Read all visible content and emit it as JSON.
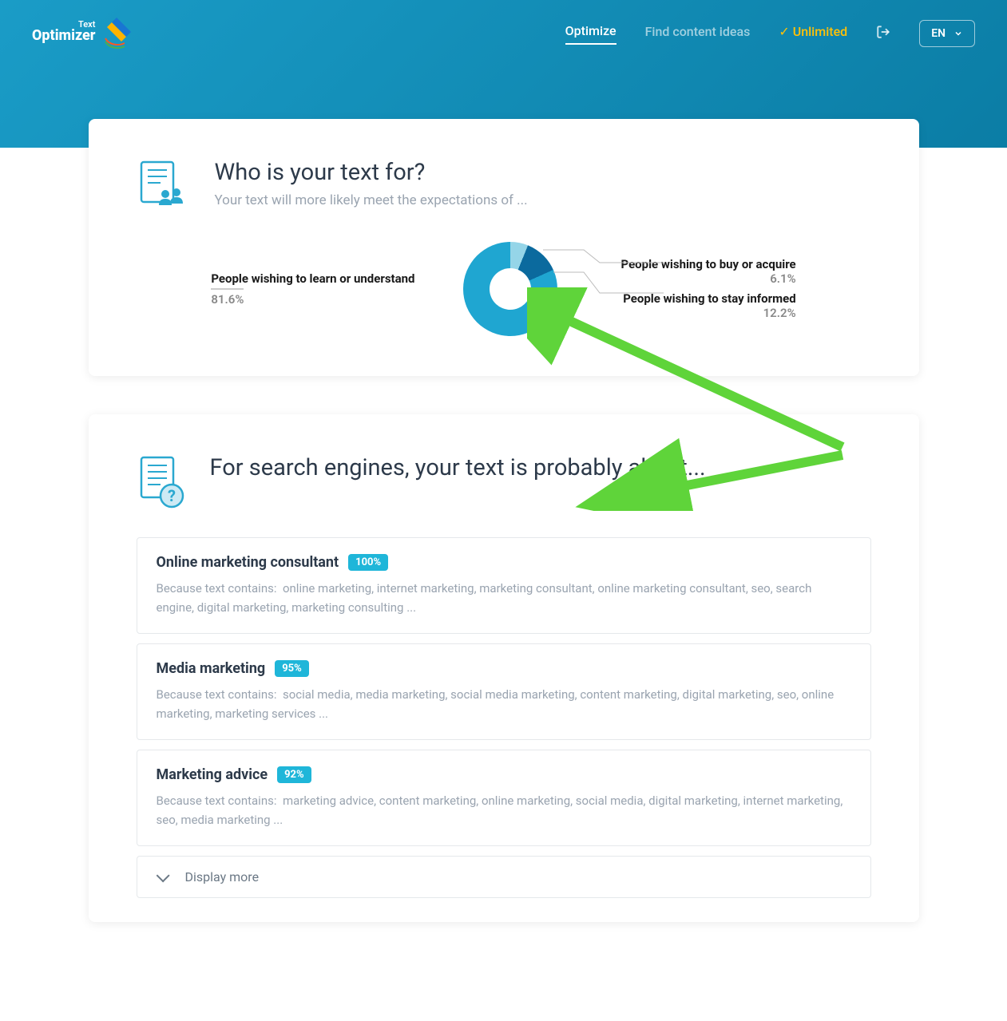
{
  "brand": "Text Optimizer",
  "nav": {
    "optimize": "Optimize",
    "find_ideas": "Find content ideas",
    "unlimited": "Unlimited",
    "lang": "EN"
  },
  "card1": {
    "title": "Who is your text for?",
    "subtitle": "Your text will more likely meet the expectations of ..."
  },
  "chart_data": {
    "type": "pie",
    "title": "Who is your text for?",
    "series": [
      {
        "name": "People wishing to learn or understand",
        "value": 81.6,
        "label": "81.6%"
      },
      {
        "name": "People wishing to buy or acquire",
        "value": 6.1,
        "label": "6.1%"
      },
      {
        "name": "People wishing to stay informed",
        "value": 12.2,
        "label": "12.2%"
      }
    ]
  },
  "card2": {
    "title": "For search engines, your text is probably about..."
  },
  "topics": [
    {
      "title": "Online marketing consultant",
      "pct": "100%",
      "reason_label": "Because text contains:",
      "reason": "online marketing, internet marketing, marketing consultant, online marketing consultant, seo, search engine, digital marketing, marketing consulting ..."
    },
    {
      "title": "Media marketing",
      "pct": "95%",
      "reason_label": "Because text contains:",
      "reason": "social media, media marketing, social media marketing, content marketing, digital marketing, seo, online marketing, marketing services ..."
    },
    {
      "title": "Marketing advice",
      "pct": "92%",
      "reason_label": "Because text contains:",
      "reason": "marketing advice, content marketing, online marketing, social media, digital marketing, internet marketing, seo, media marketing ..."
    }
  ],
  "display_more": "Display more"
}
